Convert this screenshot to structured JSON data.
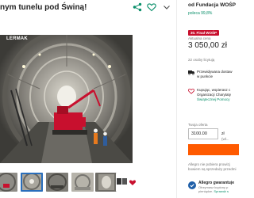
{
  "listing": {
    "title": "nym tunelu pod Świną!",
    "photo_caption": "LERMAK"
  },
  "seller": {
    "name": "od Fundacja WOŚP",
    "rating": "poleca 99,8%"
  },
  "pricing": {
    "badge": "30. Finał WOŚP",
    "price_label": "Aktualna cena",
    "price": "3 050,00 zł",
    "buyers": "22 osoby licytują"
  },
  "delivery": {
    "line1": "Przewidywana dostaw",
    "line2": "w punkcie"
  },
  "donation": {
    "line1": "Kupując, wspierasz c",
    "line2": "Organizacji Charytaty",
    "link": "Świątecznej Pomocy"
  },
  "offer": {
    "label": "Twoja oferta",
    "value": "3100.00",
    "currency": "zł",
    "min_label": "(wł..."
  },
  "info": {
    "line1": "Allegro nie pobiera prowizj",
    "line2": "bowiem są sprzedaży przedmi"
  },
  "guarantee": {
    "title": "Allegro gwarantuje",
    "line1": "Otrzymasz kupiony p",
    "line2": "pieniądze.",
    "link": "Sprawdź s"
  },
  "colors": {
    "accent_orange": "#ff5a00",
    "brand_red": "#c8102e",
    "positive_green": "#0a8f6a"
  }
}
